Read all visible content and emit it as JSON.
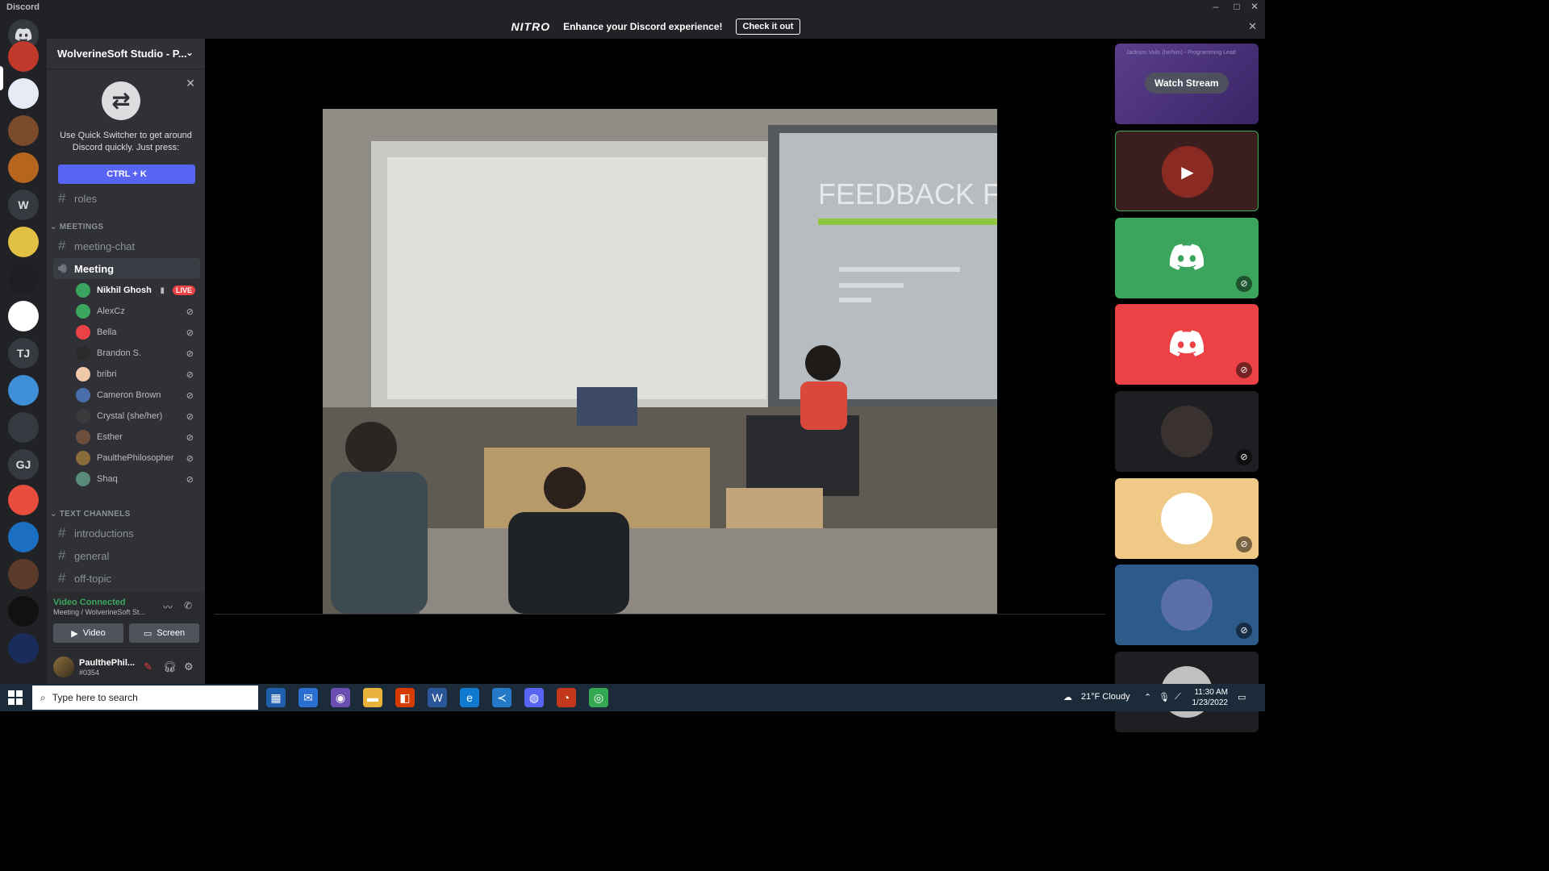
{
  "window": {
    "title": "Discord"
  },
  "banner": {
    "brand": "NITRO",
    "text": "Enhance your Discord experience!",
    "cta": "Check it out"
  },
  "servers": [
    {
      "label": "",
      "color": "#36393f"
    },
    {
      "label": "",
      "color": "#c0392b"
    },
    {
      "label": "",
      "color": "#e8eaf6"
    },
    {
      "label": "",
      "color": "#7a4a2a"
    },
    {
      "label": "",
      "color": "#b5651d"
    },
    {
      "label": "W",
      "color": "#36393f"
    },
    {
      "label": "",
      "color": "#e2c044"
    },
    {
      "label": "",
      "color": "#1e1f22"
    },
    {
      "label": "",
      "color": "#ffffff"
    },
    {
      "label": "TJ",
      "color": "#36393f"
    },
    {
      "label": "",
      "color": "#3f8ed8"
    },
    {
      "label": "",
      "color": "#36393f"
    },
    {
      "label": "GJ",
      "color": "#36393f"
    },
    {
      "label": "",
      "color": "#e74c3c"
    },
    {
      "label": "",
      "color": "#1b6ec2"
    },
    {
      "label": "",
      "color": "#5b3a29"
    },
    {
      "label": "",
      "color": "#111111"
    },
    {
      "label": "",
      "color": "#1a2c5b"
    }
  ],
  "sidebar": {
    "server_name": "WolverineSoft Studio - P...",
    "quick_switcher": {
      "message": "Use Quick Switcher to get around Discord quickly. Just press:",
      "shortcut": "CTRL + K"
    },
    "partial_channel": "roles",
    "meetings_category": "MEETINGS",
    "meeting_chat": "meeting-chat",
    "voice_channel": "Meeting",
    "voice_users": [
      {
        "name": "Nikhil Ghosh",
        "live": "LIVE",
        "color": "#3ba55d"
      },
      {
        "name": "AlexCz",
        "color": "#3ba55d"
      },
      {
        "name": "Bella",
        "color": "#ed4245"
      },
      {
        "name": "Brandon S.",
        "color": "#2a2a2a"
      },
      {
        "name": "bribri",
        "color": "#f0c9a8"
      },
      {
        "name": "Cameron Brown",
        "color": "#4a6ea9"
      },
      {
        "name": "Crystal (she/her)",
        "color": "#3a3a3a"
      },
      {
        "name": "Esther",
        "color": "#6b4e3d"
      },
      {
        "name": "PaulthePhilosopher",
        "color": "#8a6d3b"
      },
      {
        "name": "Shaq",
        "color": "#5a8a7a"
      }
    ],
    "text_category": "TEXT CHANNELS",
    "text_channels": [
      "introductions",
      "general",
      "off-topic"
    ],
    "voice_panel": {
      "status": "Video Connected",
      "location": "Meeting / WolverineSoft St...",
      "video_label": "Video",
      "screen_label": "Screen"
    },
    "user_panel": {
      "name": "PaulthePhil...",
      "tag": "#0354"
    }
  },
  "stage": {
    "slide_title": "FEEDBACK FO"
  },
  "tiles": {
    "stream_caption": "Jackson Vails (he/him) - Programming Lead",
    "watch_label": "Watch Stream",
    "colors": [
      "#4a2f7a",
      "#3b1f1f",
      "#3ba55d",
      "#ed4245",
      "#1e1f22",
      "#f0c987",
      "#2c5b8a",
      "#1e1f22"
    ]
  },
  "taskbar": {
    "search_placeholder": "Type here to search",
    "weather": "21°F  Cloudy",
    "time": "11:30 AM",
    "date": "1/23/2022"
  }
}
